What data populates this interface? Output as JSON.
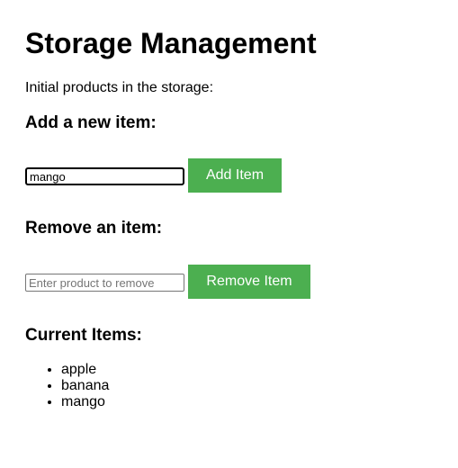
{
  "page": {
    "title": "Storage Management",
    "intro": "Initial products in the storage:"
  },
  "add_section": {
    "heading": "Add a new item:",
    "input_value": "mango",
    "button_label": "Add Item"
  },
  "remove_section": {
    "heading": "Remove an item:",
    "input_value": "",
    "input_placeholder": "Enter product to remove",
    "button_label": "Remove Item"
  },
  "current_items": {
    "heading": "Current Items:",
    "items": [
      "apple",
      "banana",
      "mango"
    ]
  },
  "colors": {
    "button_background": "#4caf50",
    "button_text": "#ffffff"
  }
}
